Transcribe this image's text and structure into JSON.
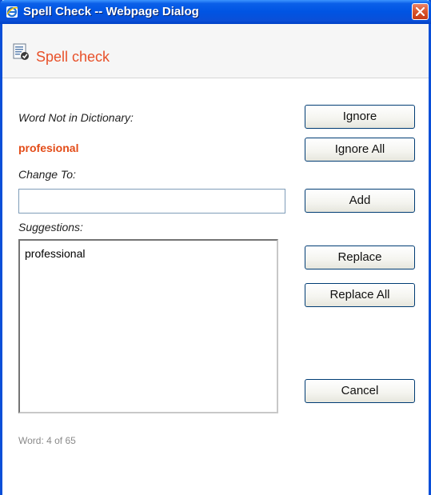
{
  "window": {
    "title": "Spell Check -- Webpage Dialog",
    "icon": "ie-icon",
    "close_icon": "close-icon",
    "accent": "#0054e3"
  },
  "header": {
    "title": "Spell check",
    "icon": "spellcheck-icon",
    "color": "#e8512a"
  },
  "form": {
    "not_in_dict_label": "Word Not in Dictionary:",
    "misspelled_word": "profesional",
    "change_to_label": "Change To:",
    "change_to_value": "",
    "suggestions_label": "Suggestions:",
    "suggestions": [
      "professional"
    ]
  },
  "buttons": {
    "ignore": "Ignore",
    "ignore_all": "Ignore All",
    "add": "Add",
    "replace": "Replace",
    "replace_all": "Replace All",
    "cancel": "Cancel"
  },
  "status": {
    "text": "Word: 4 of 65"
  }
}
